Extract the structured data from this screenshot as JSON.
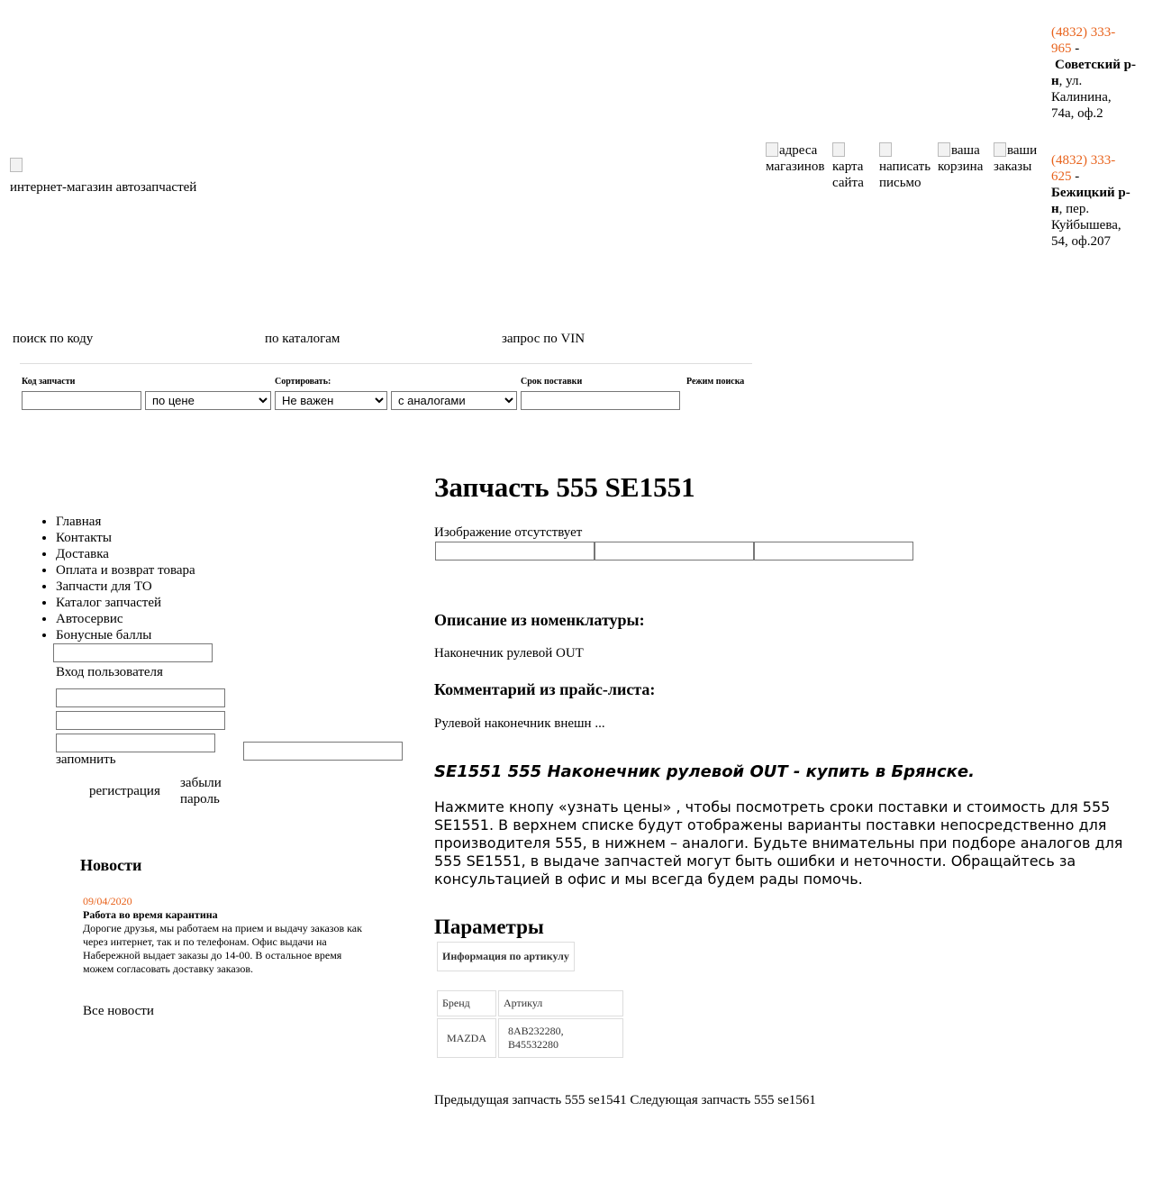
{
  "header": {
    "logo_alt": "",
    "tagline": "интернет-магазин автозапчастей",
    "nav": [
      {
        "l1": "адреса",
        "l2": "магазинов"
      },
      {
        "l1": "карта",
        "l2": "сайта"
      },
      {
        "l1": "написать",
        "l2": "письмо"
      },
      {
        "l1": "ваша",
        "l2": "корзина"
      },
      {
        "l1": "ваши",
        "l2": "заказы"
      }
    ],
    "contacts": [
      {
        "phone_a": "(4832) 333-",
        "phone_b": "965",
        "sep": " -",
        "district": "Советский р-н",
        "addr_a": ", ул.",
        "addr_b": "Калинина,",
        "addr_c": "74а, оф.2"
      },
      {
        "phone_a": "(4832) 333-",
        "phone_b": "625",
        "sep": " -",
        "district": "Бежицкий р-н",
        "addr_a": ", пер.",
        "addr_b": "Куйбышева,",
        "addr_c": "54, оф.207"
      }
    ]
  },
  "search": {
    "tabs": [
      "поиск по коду",
      "по каталогам",
      "запрос по VIN"
    ],
    "labels": {
      "code": "Код запчасти",
      "sort": "Сортировать:",
      "delivery": "Срок поставки",
      "mode": "Режим поиска"
    },
    "sort_value": "по цене",
    "delivery_value": "Не важен",
    "mode_value": "с аналогами",
    "code_value": "",
    "extra_value": ""
  },
  "menu": [
    "Главная",
    "Контакты",
    "Доставка",
    "Оплата и возврат товара",
    "Запчасти для ТО",
    "Каталог запчастей",
    "Автосервис",
    "Бонусные баллы"
  ],
  "login": {
    "title": "Вход пользователя",
    "remember": "запомнить",
    "register": "регистрация",
    "forgot_a": "забыли",
    "forgot_b": "пароль"
  },
  "news": {
    "title": "Новости",
    "date": "09/04/2020",
    "headline": "Работа во время карантина",
    "text": "Дорогие друзья, мы работаем на прием и выдачу заказов как через интернет, так и по телефонам. Офис выдачи на Набережной выдает заказы до 14-00. В остальное время можем согласовать доставку заказов.",
    "all": "Все новости"
  },
  "product": {
    "title": "Запчасть 555 SE1551",
    "no_image": "Изображение отсутствует",
    "desc_title": "Описание из номенклатуры:",
    "desc": "Наконечник рулевой OUT",
    "comment_title": "Комментарий из прайс-листа:",
    "comment": "Рулевой наконечник внешн ...",
    "seo_title": "SE1551 555 Наконечник рулевой OUT - купить в Брянске.",
    "seo_text": "Нажмите кнопу «узнать цены» , чтобы посмотреть сроки поставки и стоимость  для 555 SE1551. В верхнем списке будут отображены варианты поставки непосредственно для производителя 555, в нижнем – аналоги. Будьте внимательны при подборе аналогов для 555 SE1551, в выдаче запчастей могут быть ошибки и неточности. Обращайтесь за консультацией в офис и мы всегда будем рады помочь.",
    "params_title": "Параметры",
    "info_header": "Информация по артикулу",
    "table_headers": [
      "Бренд",
      "Артикул"
    ],
    "table_rows": [
      [
        "MAZDA",
        "8AB232280, B45532280"
      ]
    ],
    "prev_label": "Предыдущая запчасть",
    "prev_link": "555 se1541",
    "next_label": "Следующая запчасть",
    "next_link": "555 se1561"
  },
  "colors": {
    "accent": "#e8621b"
  }
}
